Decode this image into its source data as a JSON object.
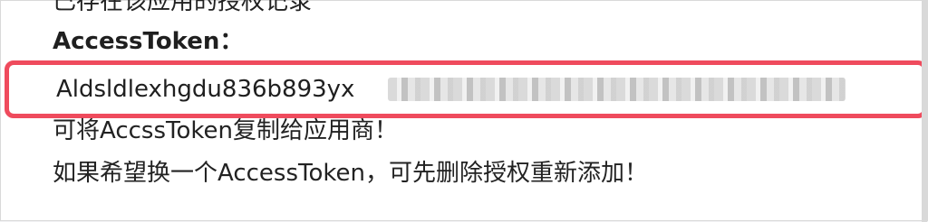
{
  "content": {
    "existing_record_text": "已存在该应用的授权记录",
    "access_token_label": "AccessToken：",
    "token_visible": "Aldsldlexhgdu836b893yx",
    "copy_hint": "可将AccssToken复制给应用商！",
    "replace_hint": "如果希望换一个AccessToken，可先删除授权重新添加！"
  }
}
